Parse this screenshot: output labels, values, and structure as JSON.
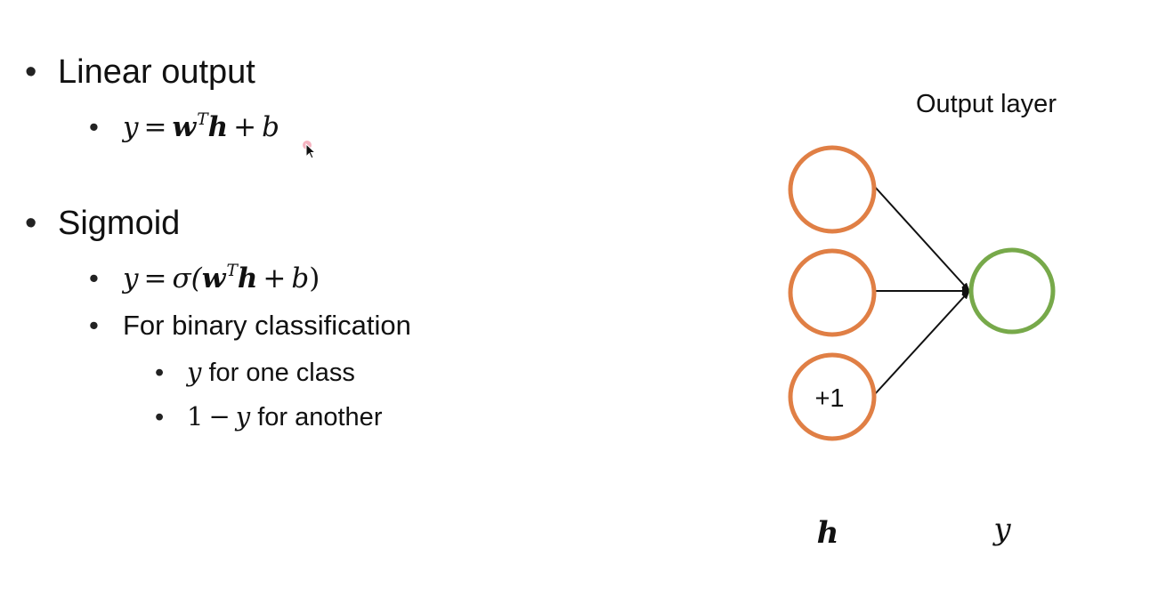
{
  "bullets": {
    "linear_output": {
      "label": "Linear output",
      "formula": {
        "lhs": "y",
        "eq": "=",
        "w": "w",
        "sup": "T",
        "h": "h",
        "plus": "+",
        "b": "b"
      }
    },
    "sigmoid": {
      "label": "Sigmoid",
      "formula": {
        "lhs": "y",
        "eq": "=",
        "sigma": "σ(",
        "w": "w",
        "sup": "T",
        "h": "h",
        "plus": "+",
        "b": "b",
        "close": ")"
      },
      "binary_label": "For binary classification",
      "one_class": {
        "var": "y",
        "text": " for one class"
      },
      "another": {
        "one": "1",
        "minus": "−",
        "var": "y",
        "text": " for another"
      }
    },
    "bullet_glyph": "•"
  },
  "diagram": {
    "title": "Output layer",
    "bias_label": "+1",
    "input_axis_label": "h",
    "output_axis_label": "y",
    "colors": {
      "input_node": "#e07f45",
      "output_node": "#77a94a",
      "edge": "#111111"
    }
  }
}
